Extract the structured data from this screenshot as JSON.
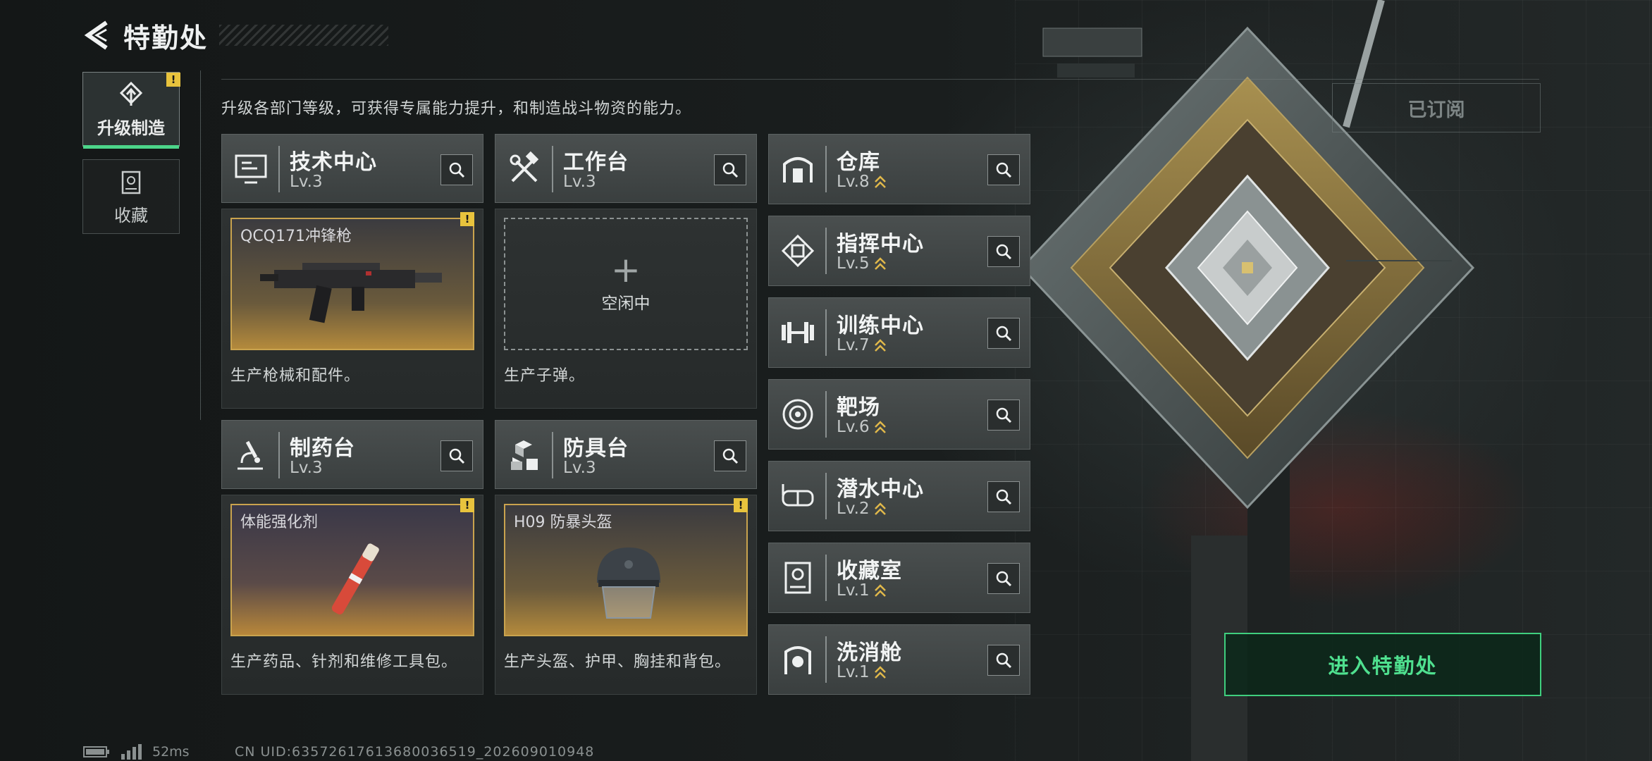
{
  "header": {
    "title": "特勤处"
  },
  "sidebar": {
    "items": [
      {
        "label": "升级制造",
        "active": true,
        "alert": "!"
      },
      {
        "label": "收藏",
        "active": false
      }
    ]
  },
  "subtitle": "升级各部门等级，可获得专属能力提升，和制造战斗物资的能力。",
  "facilities": {
    "tech": {
      "name": "技术中心",
      "level": "Lv.3",
      "product": "QCQ171冲锋枪",
      "alert": "!",
      "desc": "生产枪械和配件。"
    },
    "workbench": {
      "name": "工作台",
      "level": "Lv.3",
      "idle_text": "空闲中",
      "idle_plus": "+",
      "desc": "生产子弹。"
    },
    "pharmacy": {
      "name": "制药台",
      "level": "Lv.3",
      "product": "体能强化剂",
      "alert": "!",
      "desc": "生产药品、针剂和维修工具包。"
    },
    "armor": {
      "name": "防具台",
      "level": "Lv.3",
      "product": "H09 防暴头盔",
      "alert": "!",
      "desc": "生产头盔、护甲、胸挂和背包。"
    }
  },
  "departments": [
    {
      "name": "仓库",
      "level": "Lv.8",
      "icon": "warehouse-icon"
    },
    {
      "name": "指挥中心",
      "level": "Lv.5",
      "icon": "command-icon"
    },
    {
      "name": "训练中心",
      "level": "Lv.7",
      "icon": "dumbbell-icon"
    },
    {
      "name": "靶场",
      "level": "Lv.6",
      "icon": "target-icon"
    },
    {
      "name": "潜水中心",
      "level": "Lv.2",
      "icon": "diving-mask-icon"
    },
    {
      "name": "收藏室",
      "level": "Lv.1",
      "icon": "collection-icon"
    },
    {
      "name": "洗消舱",
      "level": "Lv.1",
      "icon": "decontamination-icon"
    }
  ],
  "subscribed_label": "已订阅",
  "enter_button": "进入特勤处",
  "footer": {
    "ping": "52ms",
    "uid": "CN UID:63572617613680036519_202609010948"
  },
  "colors": {
    "accent_green": "#4fe08f",
    "alert_yellow": "#e8c33d",
    "gold": "#c9a34e"
  }
}
